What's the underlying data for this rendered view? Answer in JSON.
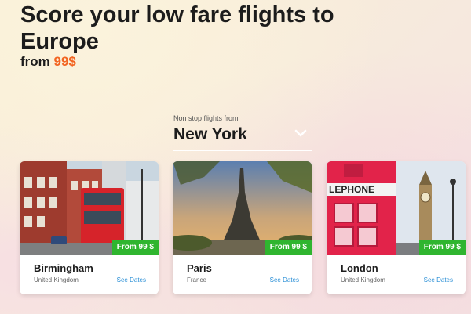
{
  "hero": {
    "headline": "Score your low fare flights to Europe",
    "from_prefix": "from ",
    "price": "99$"
  },
  "origin": {
    "label": "Non stop flights from",
    "value": "New York",
    "dropdown_icon": "chevron-down-icon"
  },
  "cards": [
    {
      "city": "Birmingham",
      "country": "United Kingdom",
      "badge": "From 99 $",
      "link": "See Dates"
    },
    {
      "city": "Paris",
      "country": "France",
      "badge": "From 99 $",
      "link": "See Dates"
    },
    {
      "city": "London",
      "country": "United Kingdom",
      "badge": "From 99 $",
      "link": "See Dates"
    }
  ],
  "colors": {
    "accent_price": "#f26522",
    "badge_green": "#2fb52f",
    "link_blue": "#2a8fd6"
  }
}
